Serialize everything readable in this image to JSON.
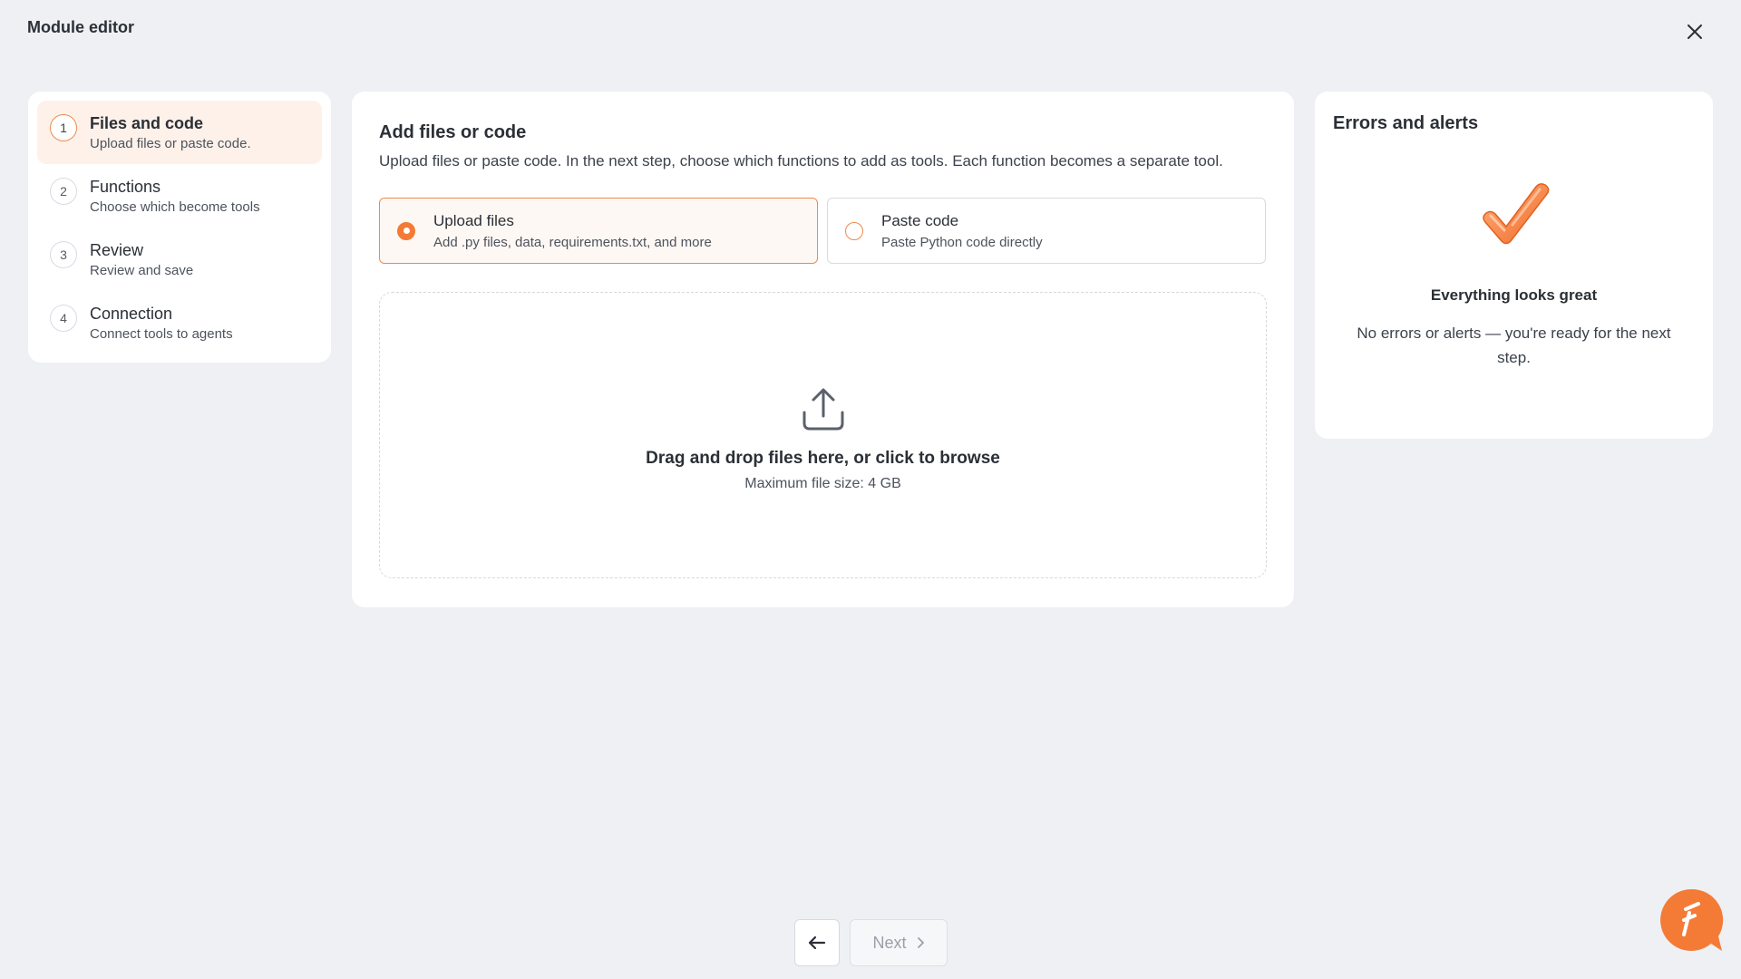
{
  "app": {
    "title": "Module editor"
  },
  "steps": [
    {
      "num": "1",
      "title": "Files and code",
      "subtitle": "Upload files or paste code."
    },
    {
      "num": "2",
      "title": "Functions",
      "subtitle": "Choose which become tools"
    },
    {
      "num": "3",
      "title": "Review",
      "subtitle": "Review and save"
    },
    {
      "num": "4",
      "title": "Connection",
      "subtitle": "Connect tools to agents"
    }
  ],
  "main": {
    "title": "Add files or code",
    "description": "Upload files or paste code. In the next step, choose which functions to add as tools. Each function becomes a separate tool.",
    "options": [
      {
        "title": "Upload files",
        "subtitle": "Add .py files, data, requirements.txt, and more"
      },
      {
        "title": "Paste code",
        "subtitle": "Paste Python code directly"
      }
    ],
    "dropzone": {
      "title": "Drag and drop files here, or click to browse",
      "subtitle": "Maximum file size: 4 GB"
    }
  },
  "alerts": {
    "title": "Errors and alerts",
    "heading": "Everything looks great",
    "message": "No errors or alerts — you're ready for the next step."
  },
  "nav": {
    "next_label": "Next"
  },
  "colors": {
    "accent": "#f47b36",
    "background": "#eef0f4"
  }
}
